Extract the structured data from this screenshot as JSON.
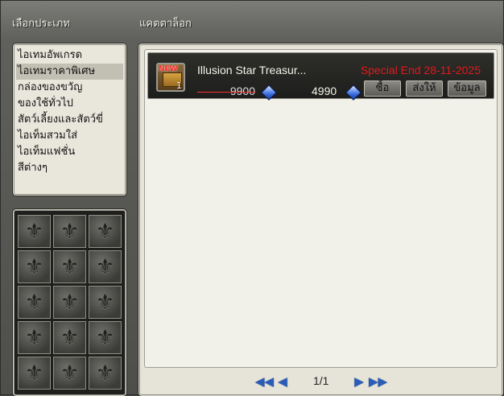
{
  "headers": {
    "category": "เลือกประเภท",
    "catalog": "แคตตาล็อก"
  },
  "categories": [
    {
      "label": "ไอเทมอัพเกรด"
    },
    {
      "label": "ไอเทมราคาพิเศษ"
    },
    {
      "label": "กล่องของขวัญ"
    },
    {
      "label": "ของใช้ทั่วไป"
    },
    {
      "label": "สัตว์เลี้ยงและสัตว์ขี่"
    },
    {
      "label": "ไอเท็มสวมใส่"
    },
    {
      "label": "ไอเท็มแฟชั่น"
    },
    {
      "label": "สีต่างๆ"
    }
  ],
  "selected_category_index": 1,
  "slot_icon": "fleur-de-lis-icon",
  "slot_glyph": "⚜",
  "item": {
    "name": "Illusion Star Treasur...",
    "special": "Special End 28-11-2025",
    "quantity": "1",
    "icon_tag": "NEW",
    "old_price": "9900",
    "new_price": "4990",
    "currency_icon": "blue-gem-icon",
    "buttons": {
      "buy": "ซื้อ",
      "gift": "ส่งให้",
      "info": "ข้อมูล"
    }
  },
  "pagination": {
    "text": "1/1",
    "first_icon": "double-left-arrow-icon",
    "prev_icon": "left-arrow-icon",
    "next_icon": "right-arrow-icon",
    "last_icon": "double-right-arrow-icon"
  },
  "colors": {
    "special_text": "#e01b1b",
    "gem": "#3b6fe0"
  }
}
